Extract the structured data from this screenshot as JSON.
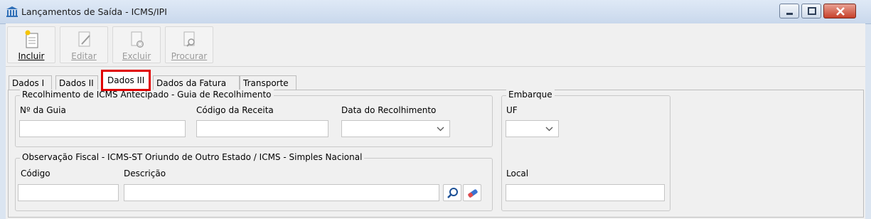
{
  "window": {
    "title": "Lançamentos de Saída - ICMS/IPI"
  },
  "toolbar": {
    "incluir": "Incluir",
    "editar": "Editar",
    "excluir": "Excluir",
    "procurar": "Procurar"
  },
  "tabs": {
    "dados1": "Dados I",
    "dados2": "Dados II",
    "dados3": "Dados III",
    "fatura": "Dados da Fatura",
    "transporte": "Transporte"
  },
  "recolhimento": {
    "title": "Recolhimento de ICMS Antecipado - Guia de Recolhimento",
    "num_guia_label": "Nº da Guia",
    "num_guia_value": "",
    "codigo_receita_label": "Código da Receita",
    "codigo_receita_value": "",
    "data_recolhimento_label": "Data do Recolhimento",
    "data_recolhimento_value": ""
  },
  "observacao": {
    "title": "Observação Fiscal - ICMS-ST Oriundo de Outro Estado / ICMS - Simples Nacional",
    "codigo_label": "Código",
    "codigo_value": "",
    "descricao_label": "Descrição",
    "descricao_value": ""
  },
  "embarque": {
    "title": "Embarque",
    "uf_label": "UF",
    "uf_value": "",
    "local_label": "Local",
    "local_value": ""
  },
  "colors": {
    "highlight": "#e00000",
    "title_bar": "#c9d8ec",
    "close_button": "#c7402a"
  },
  "icons": {
    "app": "building-columns-icon",
    "incluir": "new-document-icon",
    "editar": "edit-document-icon",
    "excluir": "delete-document-icon",
    "procurar": "search-document-icon",
    "search": "magnifier-icon",
    "clear": "eraser-icon"
  }
}
